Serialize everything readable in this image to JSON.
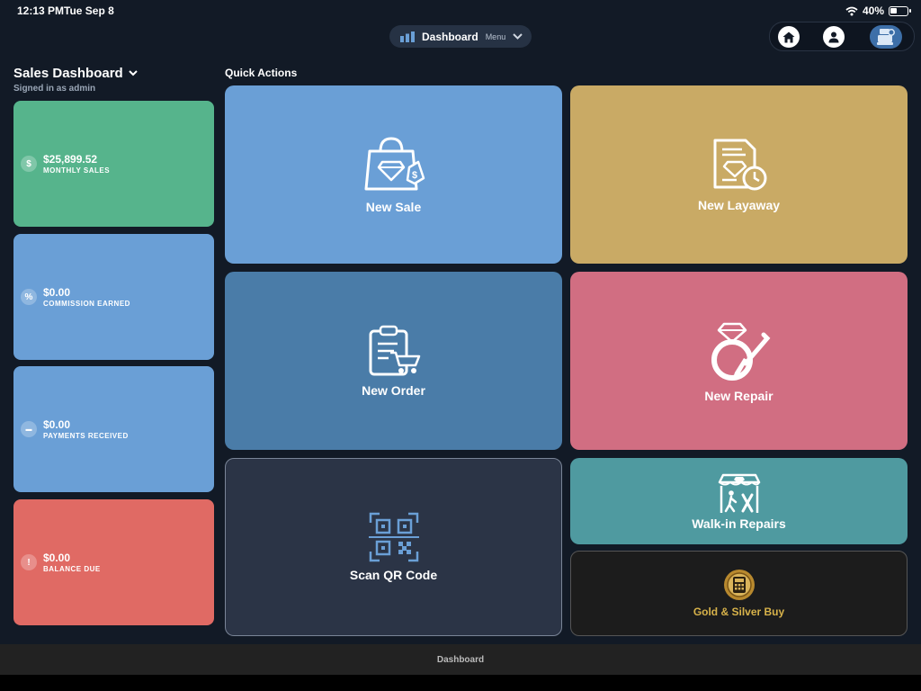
{
  "status_bar": {
    "time": "12:13 PM",
    "date": "Tue Sep 8",
    "battery": "40%"
  },
  "nav": {
    "menu_label": "Dashboard",
    "menu_sub": "Menu"
  },
  "sidebar": {
    "title": "Sales Dashboard",
    "subtitle": "Signed in as admin",
    "stats": [
      {
        "value": "$25,899.52",
        "label": "MONTHLY SALES",
        "icon_text": "$",
        "icon": "dollar-icon",
        "color": "#56b48c"
      },
      {
        "value": "$0.00",
        "label": "COMMISSION EARNED",
        "icon_text": "%",
        "icon": "percent-icon",
        "color": "#6a9fd6"
      },
      {
        "value": "$0.00",
        "label": "PAYMENTS RECEIVED",
        "icon_text": "▬",
        "icon": "card-icon",
        "color": "#6a9fd6"
      },
      {
        "value": "$0.00",
        "label": "BALANCE DUE",
        "icon_text": "!",
        "icon": "alert-icon",
        "color": "#e06a64"
      }
    ]
  },
  "quick_actions": {
    "title": "Quick Actions",
    "tiles": [
      {
        "label": "New Sale",
        "icon": "shopping-bag-diamond-icon",
        "color": "#6a9fd6"
      },
      {
        "label": "New Layaway",
        "icon": "document-clock-icon",
        "color": "#c9aa65"
      },
      {
        "label": "New Order",
        "icon": "clipboard-cart-icon",
        "color": "#4a7ca8"
      },
      {
        "label": "New Repair",
        "icon": "ring-screwdriver-icon",
        "color": "#d16e82"
      },
      {
        "label": "Scan QR Code",
        "icon": "qr-code-icon",
        "color": "#2b3446"
      },
      {
        "label": "Walk-in Repairs",
        "icon": "storefront-walk-icon",
        "color": "#4f9aa0"
      },
      {
        "label": "Gold & Silver Buy",
        "icon": "gold-coin-icon",
        "color": "#1c1c1c",
        "label_color": "#d7b24a"
      }
    ]
  },
  "bottom_bar": {
    "label": "Dashboard"
  }
}
